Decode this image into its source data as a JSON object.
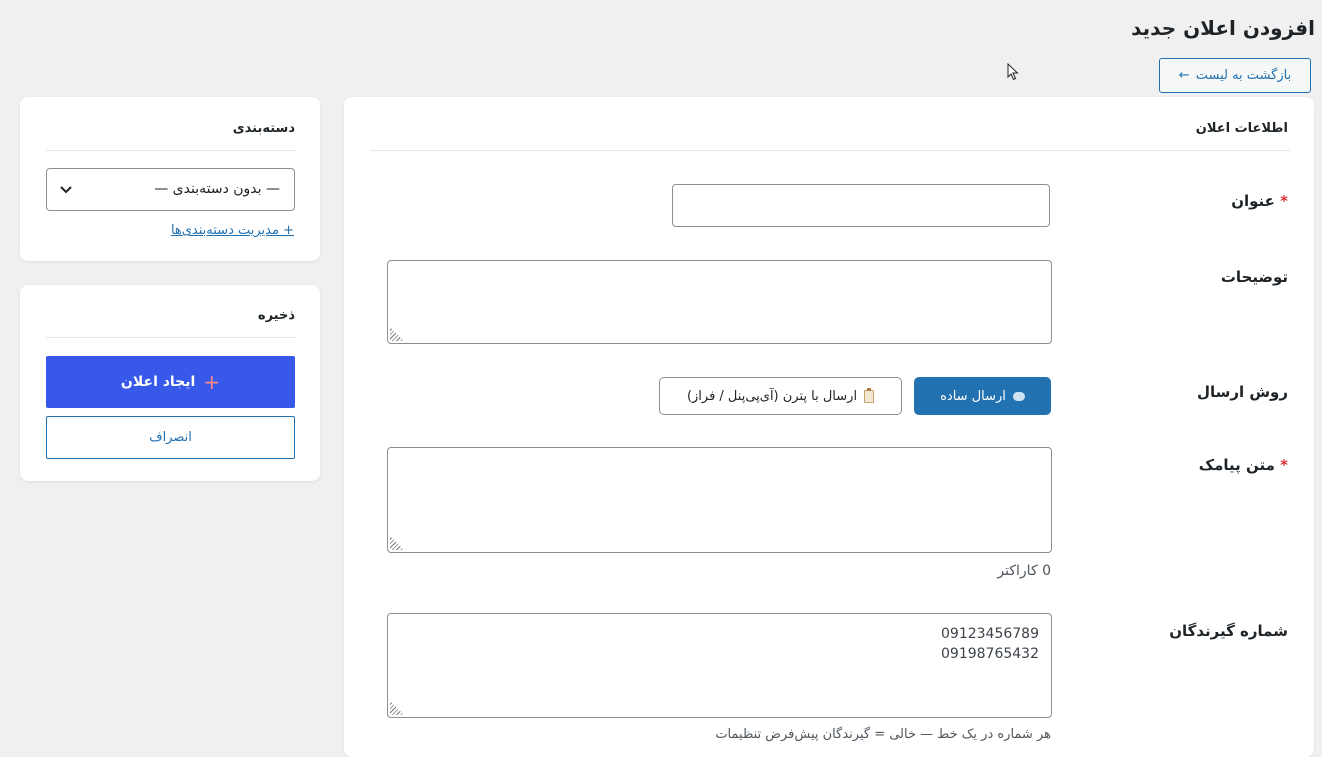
{
  "page": {
    "title": "افزودن اعلان جدید",
    "back_button": "بازگشت به لیست",
    "back_arrow": "←"
  },
  "main": {
    "section_title": "اطلاعات اعلان",
    "fields": {
      "title": {
        "label": "عنوان",
        "required_mark": "*",
        "value": ""
      },
      "description": {
        "label": "توضیحات",
        "value": ""
      },
      "send_method": {
        "label": "روش ارسال",
        "options": [
          {
            "label": "ارسال ساده",
            "icon": "speech-bubble-icon",
            "selected": true
          },
          {
            "label": "ارسال با پترن (آی‌پی‌پنل / فراز)",
            "icon": "clipboard-icon",
            "selected": false
          }
        ]
      },
      "sms_text": {
        "label": "متن پیامک",
        "required_mark": "*",
        "value": "",
        "char_count": "0 کاراکتر"
      },
      "recipients": {
        "label": "شماره گیرندگان",
        "lines": [
          "09123456789",
          "09198765432"
        ],
        "hint": "هر شماره در یک خط — خالی = گیرندگان پیش‌فرض تنظیمات"
      }
    }
  },
  "sidebar": {
    "category": {
      "title": "دسته‌بندی",
      "selected": "— بدون دسته‌بندی —",
      "manage_link": "+ مدیریت دسته‌بندی‌ها"
    },
    "save": {
      "title": "ذخیره",
      "create_button": "ایجاد اعلان",
      "create_icon": "+",
      "cancel_button": "انصراف"
    }
  },
  "colors": {
    "primary": "#2271b1",
    "create": "#3858e9",
    "required": "#d63638",
    "background": "#f0f0f1"
  }
}
